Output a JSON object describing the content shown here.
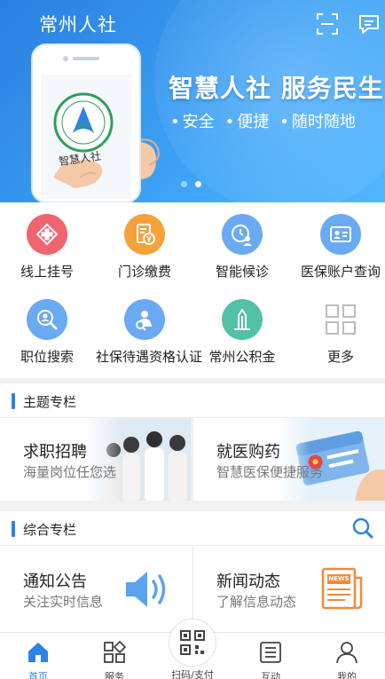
{
  "header": {
    "app_title": "常州人社",
    "scan_icon": "scan-icon",
    "message_icon": "message-icon"
  },
  "banner": {
    "headline": "智慧人社 服务民生",
    "tags": [
      "安全",
      "便捷",
      "随时随地"
    ],
    "phone_text": "智慧人社",
    "total_slides": 2,
    "active_slide": 2
  },
  "services": [
    {
      "label": "线上挂号",
      "icon": "hospital-cross-icon",
      "color": "#f06470"
    },
    {
      "label": "门诊缴费",
      "icon": "bill-yuan-icon",
      "color": "#f5a23c"
    },
    {
      "label": "智能候诊",
      "icon": "clock-person-icon",
      "color": "#6aaaf2"
    },
    {
      "label": "医保账户查询",
      "icon": "id-card-icon",
      "color": "#6aaaf2"
    },
    {
      "label": "职位搜索",
      "icon": "person-search-icon",
      "color": "#6aaaf2"
    },
    {
      "label": "社保待遇资格认证",
      "icon": "person-verify-icon",
      "color": "#6aaaf2"
    },
    {
      "label": "常州公积金",
      "icon": "building-icon",
      "color": "#52c1a6"
    },
    {
      "label": "更多",
      "icon": "grid-more-icon",
      "color": "#cfcfcf"
    }
  ],
  "topics": {
    "title": "主题专栏",
    "cards": [
      {
        "title": "求职招聘",
        "subtitle": "海量岗位任您选"
      },
      {
        "title": "就医购药",
        "subtitle": "智慧医保便捷服务"
      }
    ]
  },
  "general": {
    "title": "综合专栏",
    "search_icon": "search-icon",
    "cards": [
      {
        "title": "通知公告",
        "subtitle": "关注实时信息",
        "icon": "speaker-icon"
      },
      {
        "title": "新闻动态",
        "subtitle": "了解信息动态",
        "icon": "newspaper-icon",
        "badge": "NEWS"
      }
    ]
  },
  "tabbar": {
    "tabs": [
      {
        "label": "首页",
        "icon": "home-icon",
        "active": true
      },
      {
        "label": "服务",
        "icon": "services-grid-icon",
        "active": false
      },
      {
        "label": "扫码/支付",
        "icon": "qr-code-icon",
        "active": false
      },
      {
        "label": "互动",
        "icon": "list-icon",
        "active": false
      },
      {
        "label": "我的",
        "icon": "user-icon",
        "active": false
      }
    ]
  },
  "colors": {
    "accent": "#2d83e6",
    "banner_top": "#2c7fe0",
    "banner_bottom": "#52b6ff"
  }
}
